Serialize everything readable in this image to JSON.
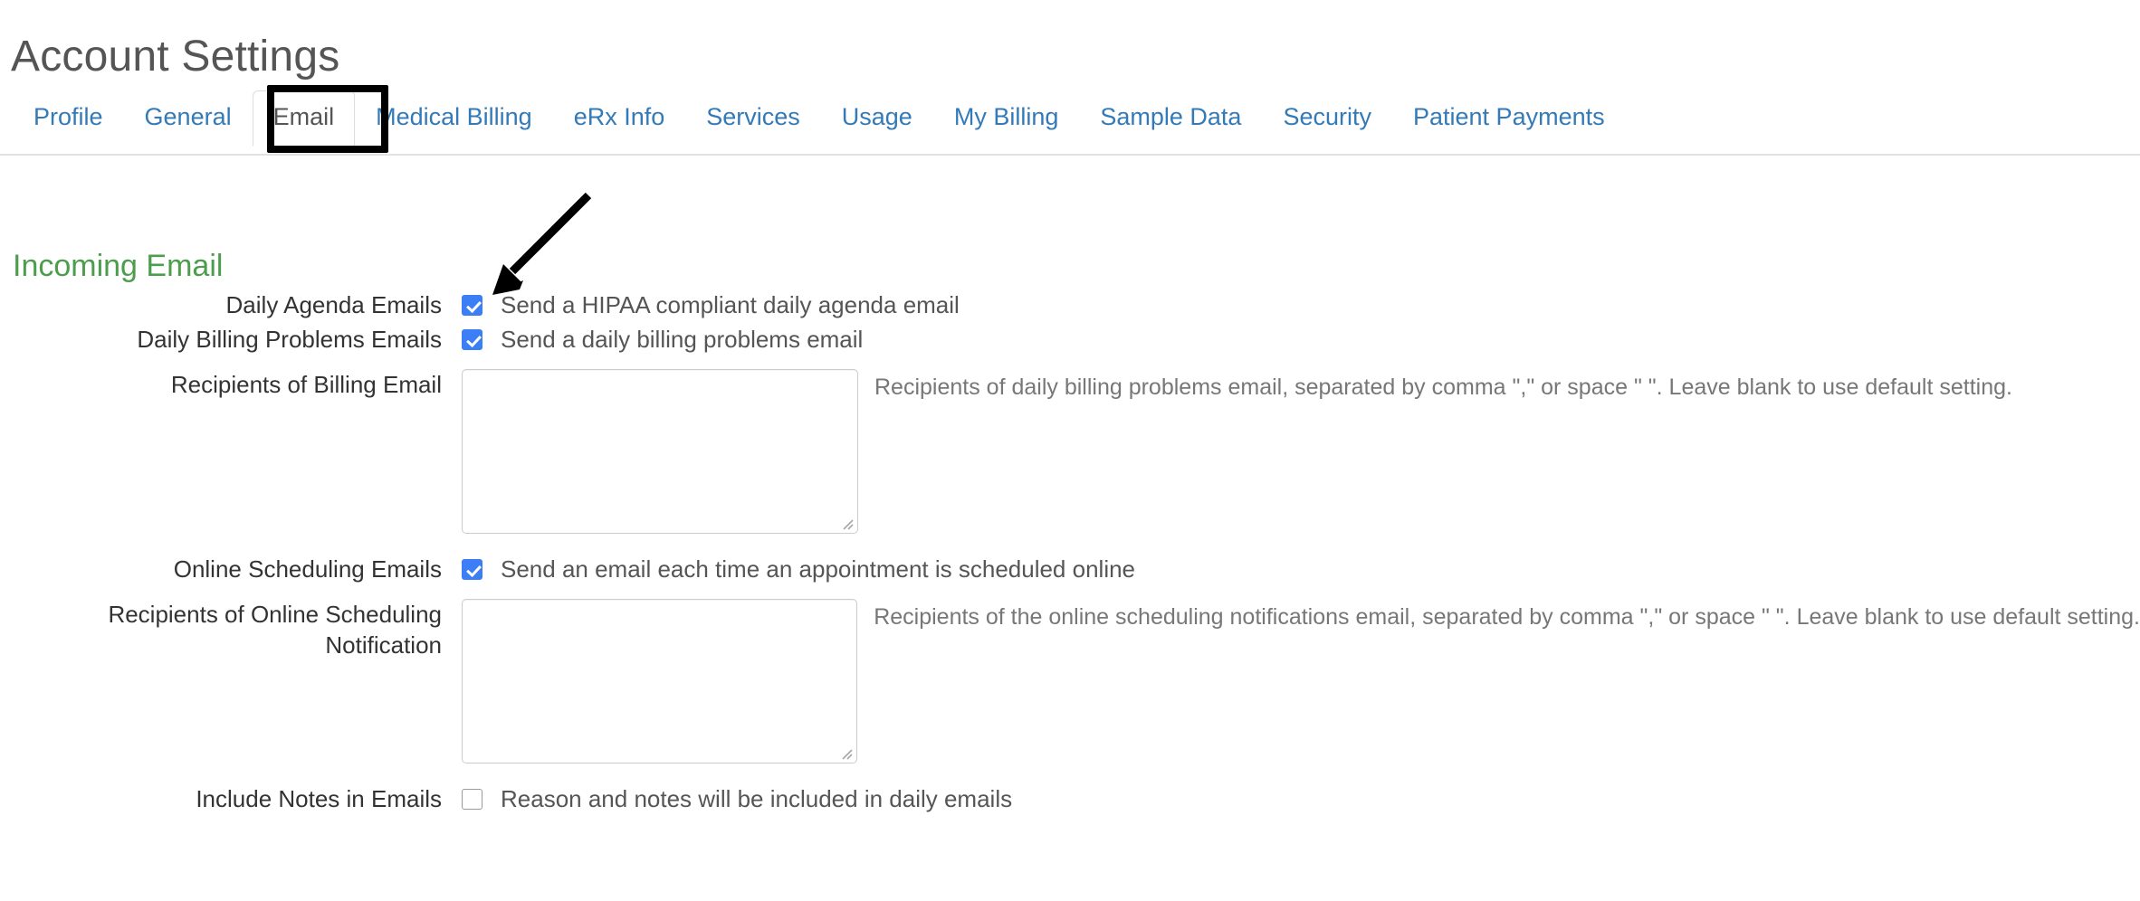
{
  "header": {
    "title": "Account Settings"
  },
  "tabs": [
    {
      "label": "Profile",
      "active": false
    },
    {
      "label": "General",
      "active": false
    },
    {
      "label": "Email",
      "active": true
    },
    {
      "label": "Medical Billing",
      "active": false
    },
    {
      "label": "eRx Info",
      "active": false
    },
    {
      "label": "Services",
      "active": false
    },
    {
      "label": "Usage",
      "active": false
    },
    {
      "label": "My Billing",
      "active": false
    },
    {
      "label": "Sample Data",
      "active": false
    },
    {
      "label": "Security",
      "active": false
    },
    {
      "label": "Patient Payments",
      "active": false
    }
  ],
  "section": {
    "title": "Incoming Email"
  },
  "fields": {
    "daily_agenda": {
      "label": "Daily Agenda Emails",
      "checkbox_text": "Send a HIPAA compliant daily agenda email",
      "checked": true
    },
    "daily_billing_problems": {
      "label": "Daily Billing Problems Emails",
      "checkbox_text": "Send a daily billing problems email",
      "checked": true
    },
    "recipients_billing": {
      "label": "Recipients of Billing Email",
      "value": "",
      "placeholder": "",
      "help": "Recipients of daily billing problems email, separated by comma \",\" or space \" \". Leave blank to use default setting."
    },
    "online_scheduling": {
      "label": "Online Scheduling Emails",
      "checkbox_text": "Send an email each time an appointment is scheduled online",
      "checked": true
    },
    "recipients_online_scheduling": {
      "label_line1": "Recipients of Online Scheduling",
      "label_line2": "Notification",
      "value": "",
      "placeholder": "",
      "help": "Recipients of the online scheduling notifications email, separated by comma \",\" or space \" \". Leave blank to use default setting."
    },
    "include_notes": {
      "label": "Include Notes in Emails",
      "checkbox_text": "Reason and notes will be included in daily emails",
      "checked": false
    }
  },
  "colors": {
    "link_blue": "#337ab7",
    "checkbox_blue": "#3b7ef5",
    "section_green": "#4c9d4c",
    "title_gray": "#555555",
    "annotation_black": "#000000"
  },
  "annotations": {
    "tab_highlight_box": "Email",
    "arrow_points_to": "daily-agenda-emails-checkbox"
  }
}
